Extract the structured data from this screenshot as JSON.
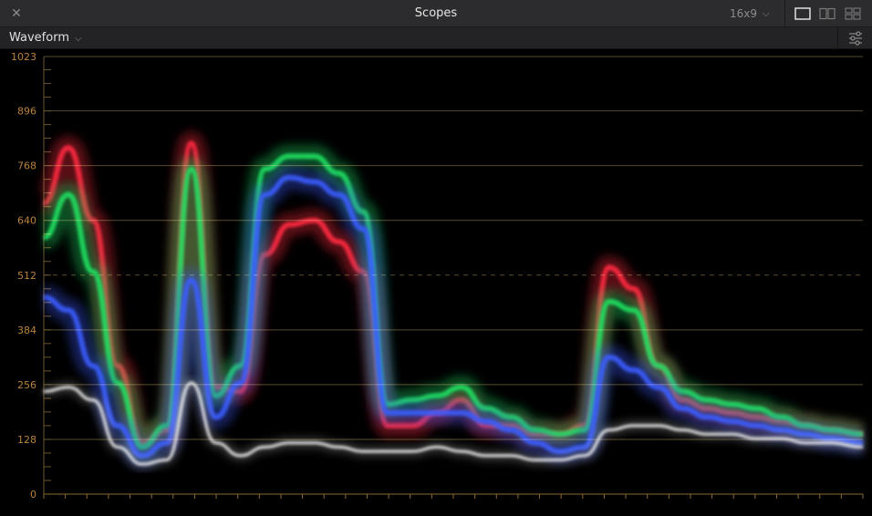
{
  "window": {
    "title": "Scopes",
    "close_icon": "close-icon",
    "aspect_ratio": "16x9",
    "layouts": [
      "single-view-icon",
      "dual-view-icon",
      "quad-view-icon"
    ],
    "active_layout": "single-view-icon"
  },
  "toolbar": {
    "scope_type": "Waveform",
    "settings_icon": "settings-sliders-icon"
  },
  "colors": {
    "grid": "#5a4a2a",
    "label": "#b8823a",
    "red": "#ff2a40",
    "green": "#1fe060",
    "blue": "#3a5cff"
  },
  "chart_data": {
    "type": "line",
    "title": "",
    "xlabel": "",
    "ylabel": "",
    "ylim": [
      0,
      1023
    ],
    "yticks": [
      "1023",
      "896",
      "768",
      "640",
      "512",
      "384",
      "256",
      "128",
      "0"
    ],
    "ytick_values": [
      1023,
      896,
      768,
      640,
      512,
      384,
      256,
      128,
      0
    ],
    "dashed_line": 512,
    "x": [
      0,
      0.03,
      0.06,
      0.09,
      0.12,
      0.15,
      0.18,
      0.21,
      0.24,
      0.27,
      0.3,
      0.33,
      0.36,
      0.39,
      0.42,
      0.45,
      0.48,
      0.51,
      0.54,
      0.57,
      0.6,
      0.63,
      0.66,
      0.69,
      0.72,
      0.75,
      0.78,
      0.81,
      0.84,
      0.87,
      0.9,
      0.93,
      0.96,
      1.0
    ],
    "series": [
      {
        "name": "",
        "color": "#ff2a40",
        "values": [
          680,
          810,
          640,
          300,
          120,
          150,
          820,
          250,
          240,
          560,
          630,
          640,
          590,
          520,
          160,
          160,
          190,
          220,
          160,
          160,
          140,
          140,
          160,
          530,
          480,
          300,
          220,
          200,
          190,
          180,
          170,
          160,
          150,
          140
        ]
      },
      {
        "name": "",
        "color": "#1fe060",
        "values": [
          600,
          700,
          520,
          260,
          110,
          160,
          760,
          230,
          300,
          760,
          790,
          790,
          750,
          660,
          210,
          220,
          230,
          250,
          200,
          180,
          150,
          140,
          150,
          450,
          430,
          300,
          240,
          220,
          210,
          200,
          180,
          160,
          150,
          140
        ]
      },
      {
        "name": "",
        "color": "#3a5cff",
        "values": [
          460,
          430,
          300,
          160,
          90,
          120,
          500,
          180,
          260,
          700,
          740,
          730,
          700,
          620,
          190,
          190,
          190,
          190,
          170,
          150,
          120,
          100,
          110,
          320,
          290,
          250,
          200,
          180,
          170,
          160,
          150,
          140,
          130,
          120
        ]
      },
      {
        "name": "",
        "color": "#ffffff",
        "values": [
          240,
          250,
          220,
          110,
          70,
          80,
          260,
          120,
          90,
          110,
          120,
          120,
          110,
          100,
          100,
          100,
          110,
          100,
          90,
          90,
          80,
          80,
          90,
          150,
          160,
          160,
          150,
          140,
          140,
          130,
          130,
          120,
          120,
          110
        ]
      }
    ]
  }
}
